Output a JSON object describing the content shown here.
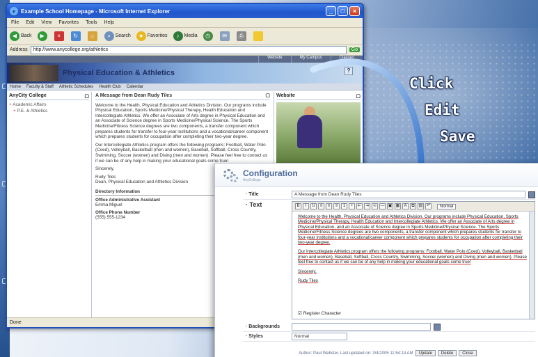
{
  "browser": {
    "title": "Example School Homepage - Microsoft Internet Explorer",
    "menu": [
      "File",
      "Edit",
      "View",
      "Favorites",
      "Tools",
      "Help"
    ],
    "toolbar": {
      "back": "Back",
      "search": "Search",
      "favorites": "Favorites",
      "media": "Media"
    },
    "address_label": "Address",
    "address_value": "http://www.anycollege.org/athletics",
    "go_label": "Go",
    "status": "Done"
  },
  "site": {
    "top_links": [
      "Website",
      "My Campus",
      "Classes"
    ],
    "banner_title": "Physical Education & Athletics",
    "nav": [
      "Home",
      "Faculty & Staff",
      "Athletic Schedules",
      "Health Club",
      "Calendar"
    ],
    "left_panel": {
      "title": "AnyCity College",
      "items": [
        "Academic Affairs",
        "P.E. & Athletics"
      ]
    },
    "main_panel": {
      "title": "A Message from Dean Rudy Tiles",
      "paragraphs": [
        "Welcome to the Health, Physical Education and Athletics Division. Our programs include Physical Education, Sports Medicine/Physical Therapy, Health Education and Intercollegiate Athletics. We offer an Associate of Arts degree in Physical Education and an Associate of Science degree in Sports Medicine/Physical Science. The Sports Medicine/Fitness Science degrees are two components, a transfer component which prepares students for transfer to four-year institutions and a vocational/career component which prepares students for occupation after completing their two-year degree.",
        "Our Intercollegiate Athletics program offers the following programs: Football, Water Polo (Coed), Volleyball, Basketball (men and women), Baseball, Softball, Cross Country, Swimming, Soccer (women) and Diving (men and women). Please feel free to contact us if we can be of any help in making your educational goals come true!",
        "Sincerely,",
        "Rudy Tiles\nDean, Physical Education and Athletics Division"
      ],
      "directory_title": "Directory Information",
      "directory": [
        {
          "label": "Office Administrative Assistant",
          "value": "Emma Miguel"
        },
        {
          "label": "Office Phone Number",
          "value": "(555) 555-1234"
        }
      ]
    },
    "right_panel": {
      "title": "Website"
    }
  },
  "callouts": {
    "click": "Click",
    "edit": "Edit",
    "save": "Save"
  },
  "config": {
    "title": "Configuration",
    "subtitle": "AnyCollege",
    "fields": {
      "title_label": "Title",
      "title_value": "A Message from Dean Rudy Tiles",
      "text_label": "Text",
      "font_select": "Normal",
      "backgrounds_label": "Backgrounds",
      "backgrounds_value": "",
      "styles_label": "Styles",
      "styles_value": "Normal",
      "checkbox_label": "Register Character"
    },
    "editor_paragraphs": [
      "Welcome to the Health, Physical Education and Athletics Division. Our programs include Physical Education, Sports Medicine/Physical Therapy, Health Education and Intercollegiate Athletics. We offer an Associate of Arts degree in Physical Education, and an Associate of Science degree in Sports Medicine/Physical Science. The Sports Medicine/Fitness Science degrees are two components, a transfer component which prepares students for transfer to four-year institutions and a vocational/career component which prepares students for occupation after completing their two-year degree.",
      "Our Intercollegiate Athletics program offers the following programs: Football, Water Polo (Coed), Volleyball, Basketball (men and women), Baseball, Softball, Cross Country, Swimming, Soccer (women) and Diving (men and women). Please feel free to contact us if we can be of any help in making your educational goals come true!",
      "Sincerely,",
      "Rudy Tiles"
    ],
    "footer": {
      "author_text": "Author: Paul Webster. Last updated on: 3/4/2005 11:54:14 AM",
      "buttons": [
        "Update",
        "Delete",
        "Close"
      ]
    }
  }
}
